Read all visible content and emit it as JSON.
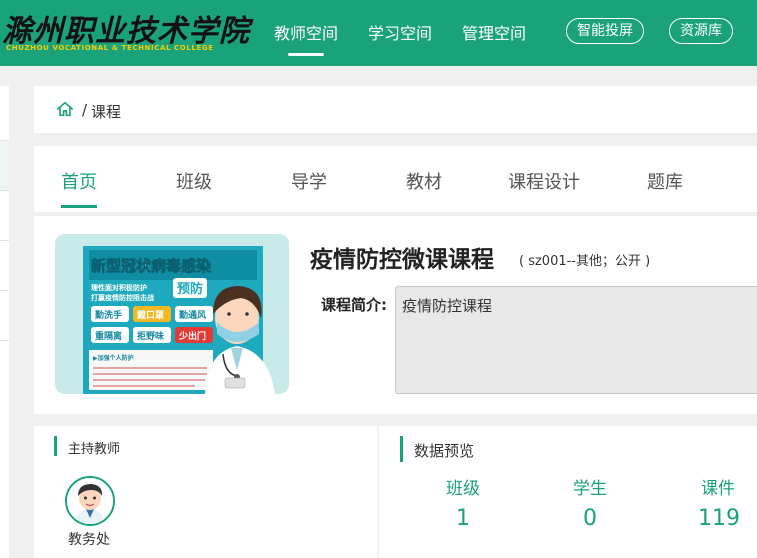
{
  "header": {
    "logo_cn": "滁州职业技术学院",
    "logo_en": "CHUZHOU VOCATIONAL & TECHNICAL COLLEGE",
    "nav": [
      "教师空间",
      "学习空间",
      "管理空间"
    ],
    "buttons": [
      "智能投屏",
      "资源库"
    ]
  },
  "breadcrumb": {
    "separator": "/",
    "current": "课程"
  },
  "tabs": [
    "首页",
    "班级",
    "导学",
    "教材",
    "课程设计",
    "题库"
  ],
  "course": {
    "title": "疫情防控微课课程",
    "meta": "( sz001--其他；公开 )",
    "intro_label": "课程简介:",
    "intro_text": "疫情防控课程"
  },
  "cover": {
    "headline": "新型冠状病毒感染",
    "badge": "预防",
    "subline1": "理性面对积极防护",
    "subline2": "打赢疫情防控阻击战",
    "tags": [
      "勤洗手",
      "戴口罩",
      "勤通风",
      "重隔离",
      "拒野味",
      "少出门"
    ],
    "notice_title": "▶加强个人防护"
  },
  "teacher_panel": {
    "title": "主持教师",
    "teacher_name": "教务处"
  },
  "stats_panel": {
    "title": "数据预览",
    "stats": [
      {
        "label": "班级",
        "value": "1"
      },
      {
        "label": "学生",
        "value": "0"
      },
      {
        "label": "课件",
        "value": "119"
      }
    ]
  },
  "colors": {
    "brand": "#1aa37a",
    "background": "#f0f0f0"
  }
}
